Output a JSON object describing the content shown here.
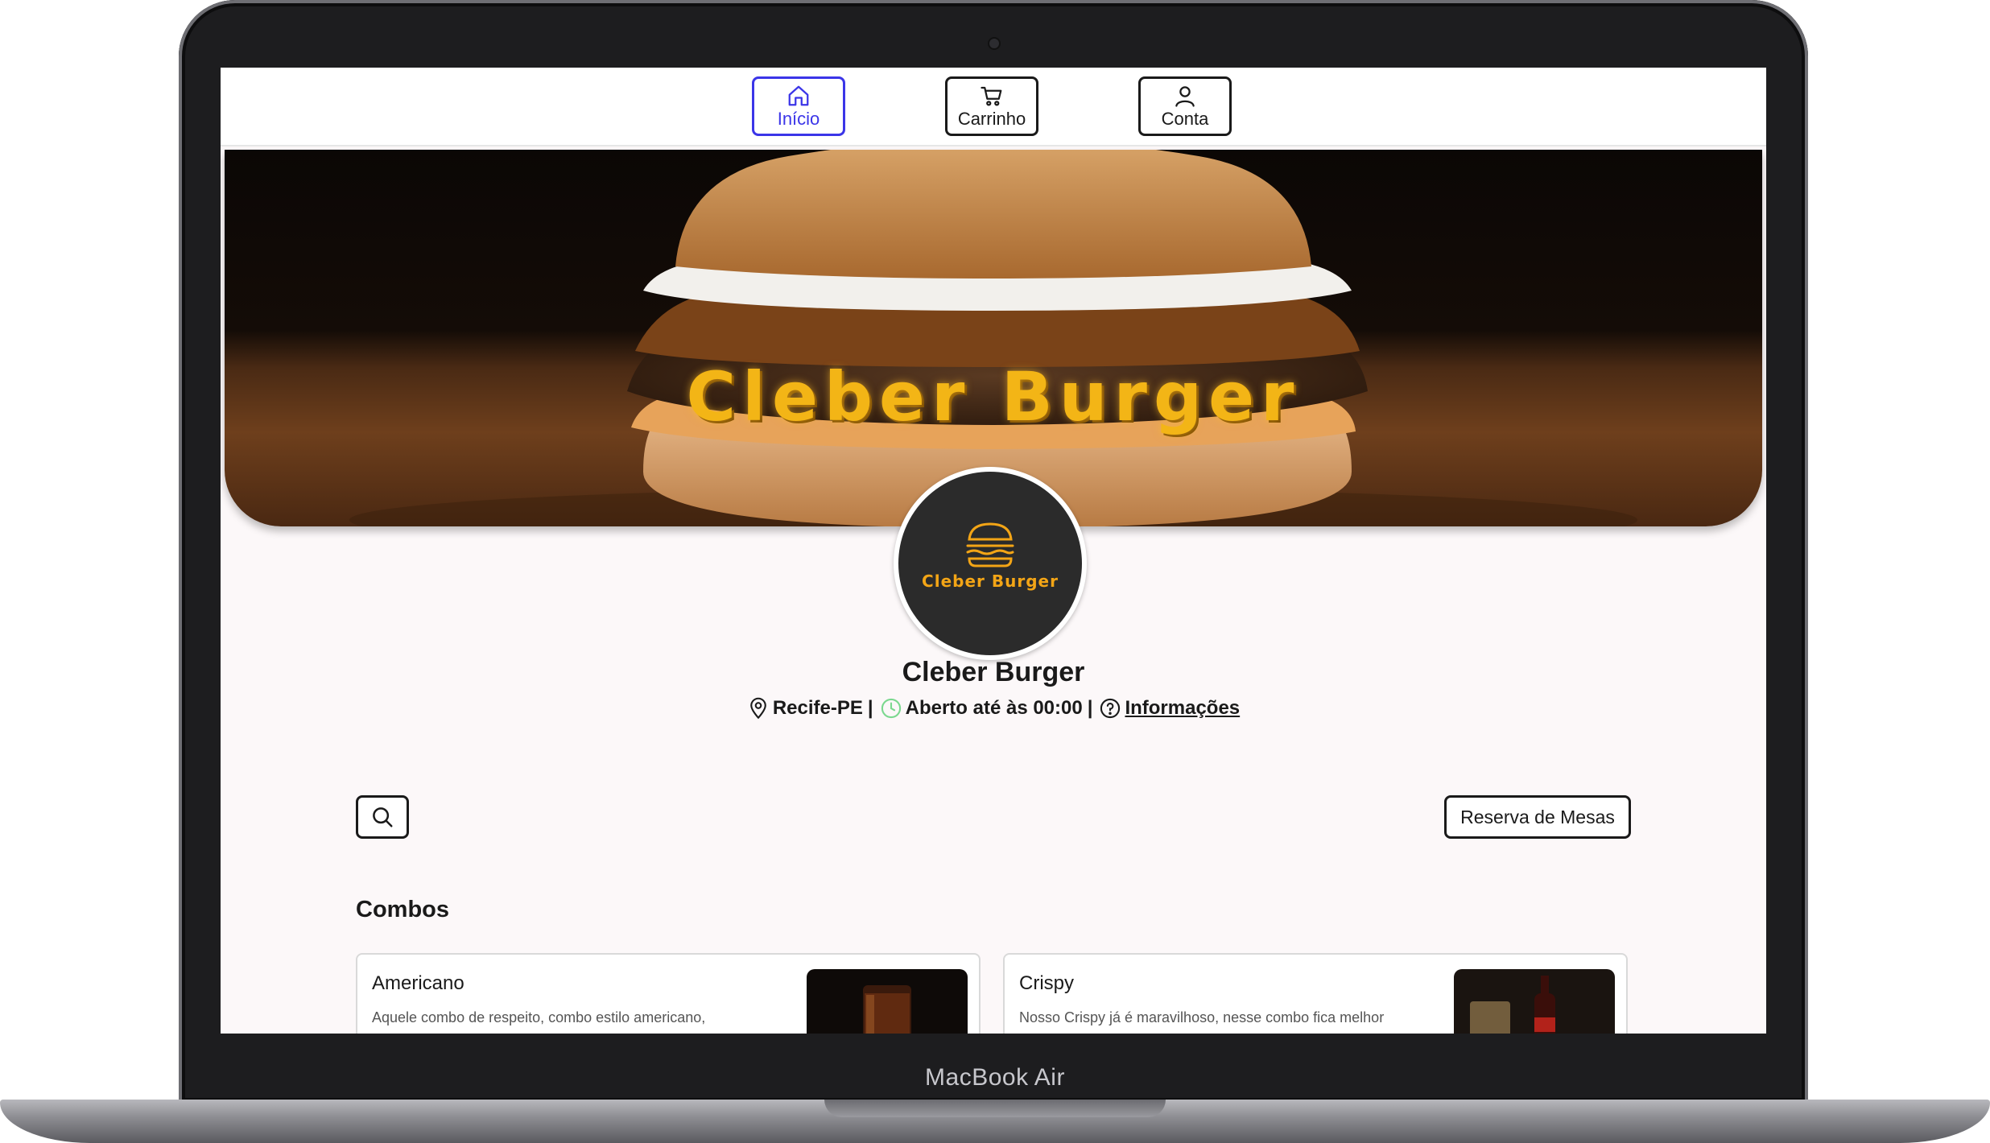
{
  "device": {
    "label": "MacBook Air"
  },
  "nav": {
    "items": [
      {
        "label": "Início",
        "icon": "home-icon",
        "active": true
      },
      {
        "label": "Carrinho",
        "icon": "cart-icon",
        "active": false
      },
      {
        "label": "Conta",
        "icon": "user-icon",
        "active": false
      }
    ]
  },
  "banner": {
    "title": "Cleber Burger"
  },
  "logo": {
    "text": "Cleber Burger",
    "icon": "burger-icon"
  },
  "store": {
    "name": "Cleber Burger",
    "location": "Recife-PE",
    "hours": "Aberto até às 00:00",
    "info_link": "Informações",
    "separator": "|"
  },
  "actions": {
    "reserve_label": "Reserva de Mesas",
    "search_icon": "search-icon"
  },
  "section": {
    "title": "Combos"
  },
  "products": [
    {
      "title": "Americano",
      "description": "Aquele combo de respeito, combo estilo americano,"
    },
    {
      "title": "Crispy",
      "description": "Nosso Crispy já é maravilhoso, nesse combo fica melhor"
    }
  ],
  "colors": {
    "accent": "#3b35e8",
    "brand_yellow": "#f3b516",
    "open_status": "#7bd88f"
  }
}
